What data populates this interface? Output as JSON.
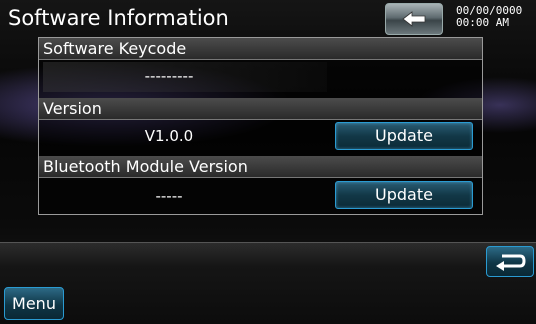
{
  "header": {
    "title": "Software Information",
    "back_icon": "left-arrow-icon",
    "date": "00/00/0000",
    "time": "00:00 AM"
  },
  "sections": [
    {
      "label": "Software Keycode",
      "value": "---------"
    },
    {
      "label": "Version",
      "value": "V1.0.0",
      "button_label": "Update"
    },
    {
      "label": "Bluetooth Module Version",
      "value": "-----",
      "button_label": "Update"
    }
  ],
  "footer": {
    "return_icon": "return-arrow-icon",
    "menu_label": "Menu"
  },
  "colors": {
    "accent_border": "#2a9bd2",
    "button_fill": "#123847"
  }
}
